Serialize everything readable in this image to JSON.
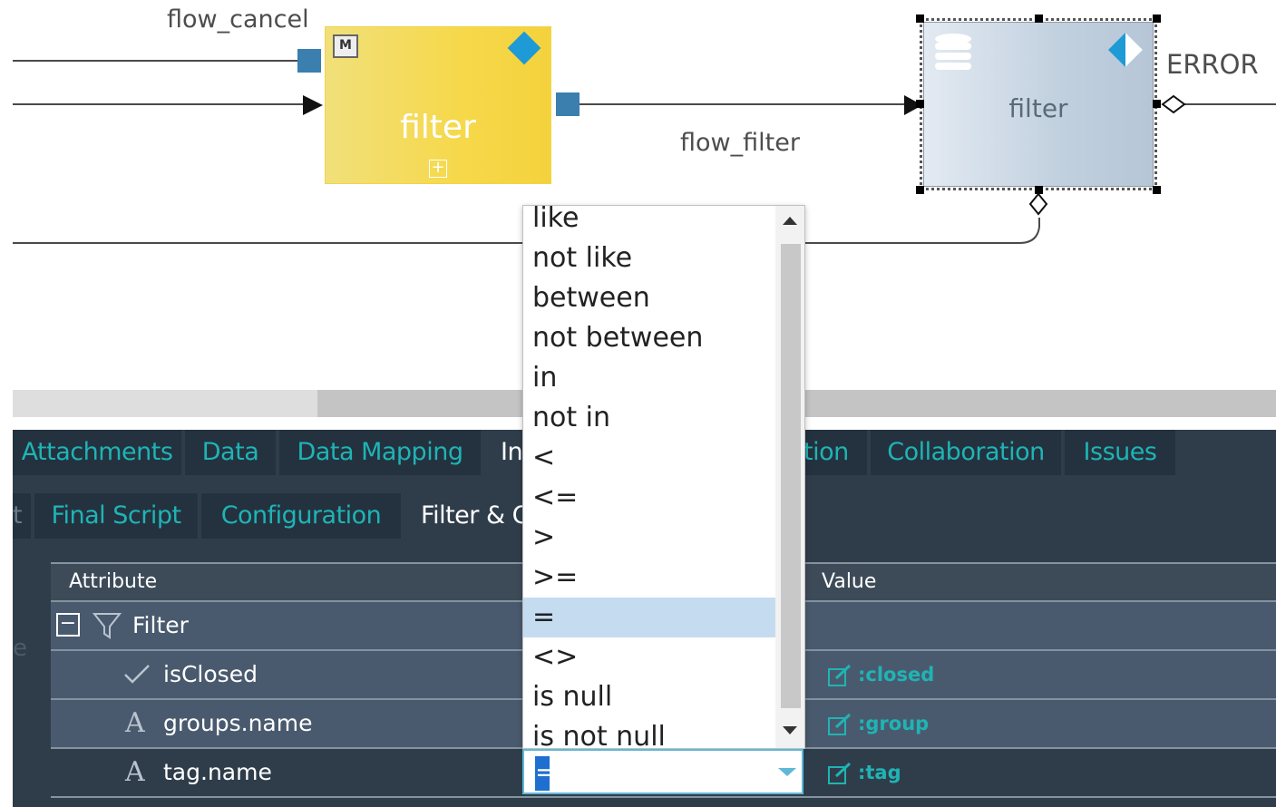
{
  "canvas": {
    "flows": {
      "flow_cancel": "flow_cancel",
      "flow_filter": "flow_filter",
      "error": "ERROR"
    },
    "nodes": {
      "yellow": {
        "title": "filter",
        "badge": "M",
        "expand": "+"
      },
      "blue": {
        "title": "filter"
      }
    }
  },
  "tabs": [
    {
      "label": "Attachments"
    },
    {
      "label": "Data"
    },
    {
      "label": "Data Mapping"
    },
    {
      "label": "In"
    },
    {
      "label": "tion"
    },
    {
      "label": "Collaboration"
    },
    {
      "label": "Issues"
    }
  ],
  "subtabs": [
    {
      "label": "t"
    },
    {
      "label": "Final Script"
    },
    {
      "label": "Configuration"
    },
    {
      "label": "Filter & C"
    }
  ],
  "grid": {
    "headers": {
      "attribute": "Attribute",
      "value": "Value"
    },
    "group": {
      "label": "Filter",
      "collapse": "−"
    },
    "rows": [
      {
        "attribute": "isClosed",
        "value": ":closed"
      },
      {
        "attribute": "groups.name",
        "value": ":group"
      },
      {
        "attribute": "tag.name",
        "value": ":tag"
      }
    ],
    "side_letter": "e"
  },
  "dropdown": {
    "options": [
      "like",
      "not like",
      "between",
      "not between",
      "in",
      "not in",
      "<",
      "<=",
      ">",
      ">=",
      "=",
      "<>",
      "is null",
      "is not null"
    ],
    "selected": "=",
    "combo_value": "="
  },
  "colors": {
    "accent": "#1fb4b4",
    "panel": "#2f3d4b",
    "node_yellow": "#f4d23c",
    "port_blue": "#3a7fae"
  }
}
